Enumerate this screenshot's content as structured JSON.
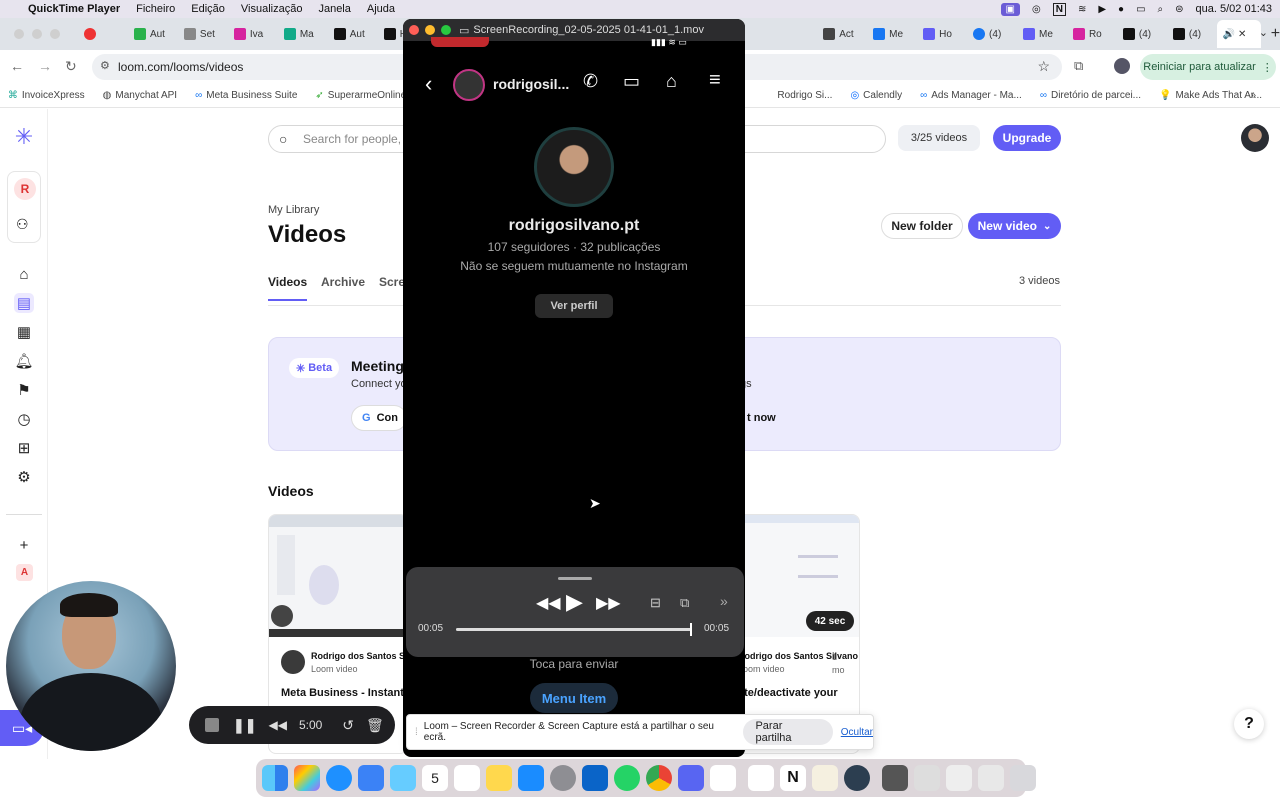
{
  "menubar": {
    "app": "QuickTime Player",
    "items": [
      "Ficheiro",
      "Edição",
      "Visualização",
      "Janela",
      "Ajuda"
    ],
    "clock": "qua. 5/02  01:43"
  },
  "tabs": [
    "Aut",
    "Set",
    "Iva",
    "Ma",
    "Aut",
    "Ho",
    "Act",
    "Me",
    "Ho",
    "(4)",
    "Me",
    "Ro",
    "(4)",
    "(4)"
  ],
  "address": {
    "url": "loom.com/looms/videos",
    "update_button": "Reiniciar para atualizar"
  },
  "bookmarks": [
    "InvoiceXpress",
    "Manychat API",
    "Meta Business Suite",
    "SuperarmeOnline...",
    "Rodrigo Si...",
    "Calendly",
    "Ads Manager - Ma...",
    "Diretório de parcei...",
    "Make Ads That Ar..."
  ],
  "loom": {
    "search_placeholder": "Search for people, tags, folders, Spaces, and Looms",
    "usage": "3/25 videos",
    "upgrade": "Upgrade",
    "breadcrumb": "My Library",
    "title": "Videos",
    "new_folder": "New folder",
    "new_video": "New video",
    "tabs": [
      "Videos",
      "Archive",
      "Screenshots"
    ],
    "count": "3 videos",
    "banner": {
      "badge": "Beta",
      "title": "Meeting",
      "subtitle": "Connect yo",
      "sub_right": "gs",
      "connect": "Con",
      "cta": "t now"
    },
    "section": "Videos",
    "cards": [
      {
        "author": "Rodrigo dos Santos S",
        "type": "Loom video",
        "title": "Meta Business - Instant"
      },
      {
        "author": "Rodrigo dos Santos Silvano",
        "age": "1 mo",
        "type": "Loom video",
        "title": "ate/deactivate your",
        "duration": "42 sec"
      }
    ]
  },
  "quicktime": {
    "file": "ScreenRecording_02-05-2025 01-41-01_1.mov",
    "profile": {
      "user": "rodrigosil...",
      "handle": "rodrigosilvano.pt",
      "stats": "107 seguidores · 32 publicações",
      "mutual": "Não se seguem mutuamente no Instagram",
      "view_profile": "Ver perfil"
    },
    "time_start": "00:05",
    "time_end": "00:05",
    "progress": 1.0,
    "tap_send": "Toca para enviar",
    "menu_item": "Menu Item"
  },
  "share_bar": {
    "text": "Loom – Screen Recorder & Screen Capture está a partilhar o seu ecrã.",
    "stop": "Parar partilha",
    "hide": "Ocultar"
  },
  "recorder": {
    "timer": "5:00"
  },
  "help": "?"
}
